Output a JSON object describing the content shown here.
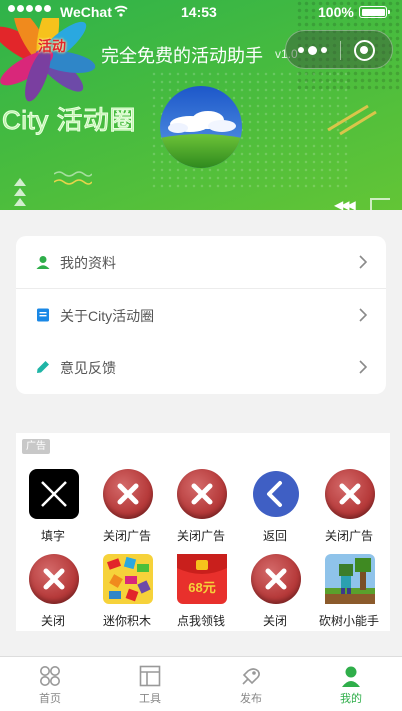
{
  "status_bar": {
    "carrier": "WeChat",
    "time": "14:53",
    "battery": "100%"
  },
  "header": {
    "logo_text": "活动",
    "title": "完全免费的活动助手",
    "version": "v1.0",
    "brand": "City 活动圈"
  },
  "menu": {
    "items": [
      {
        "label": "我的资料",
        "icon": "user-icon",
        "icon_color": "#2fae4a"
      },
      {
        "label": "关于City活动圈",
        "icon": "document-icon",
        "icon_color": "#1a88e6"
      },
      {
        "label": "意见反馈",
        "icon": "pencil-icon",
        "icon_color": "#1fb5a6"
      }
    ]
  },
  "ad": {
    "badge": "广告",
    "items": [
      {
        "label": "填字",
        "icon": "crossword-x-icon"
      },
      {
        "label": "关闭广告",
        "icon": "close-icon"
      },
      {
        "label": "关闭广告",
        "icon": "close-icon"
      },
      {
        "label": "返回",
        "icon": "back-icon"
      },
      {
        "label": "关闭广告",
        "icon": "close-icon"
      },
      {
        "label": "关闭",
        "icon": "close-icon"
      },
      {
        "label": "迷你积木",
        "icon": "mini-blocks-icon"
      },
      {
        "label": "点我领钱",
        "icon": "red-envelope-icon",
        "icon_text": "68元"
      },
      {
        "label": "关闭",
        "icon": "close-icon"
      },
      {
        "label": "砍树小能手",
        "icon": "minecraft-icon"
      }
    ]
  },
  "tabbar": {
    "tabs": [
      {
        "label": "首页",
        "icon": "home-grid-icon",
        "active": false
      },
      {
        "label": "工具",
        "icon": "tools-icon",
        "active": false
      },
      {
        "label": "发布",
        "icon": "publish-icon",
        "active": false
      },
      {
        "label": "我的",
        "icon": "profile-icon",
        "active": true
      }
    ]
  },
  "colors": {
    "brand_green": "#2fae4a",
    "banner_green": "#46bb3f",
    "close_red": "#b63a3a",
    "back_blue": "#3f5fc4"
  }
}
